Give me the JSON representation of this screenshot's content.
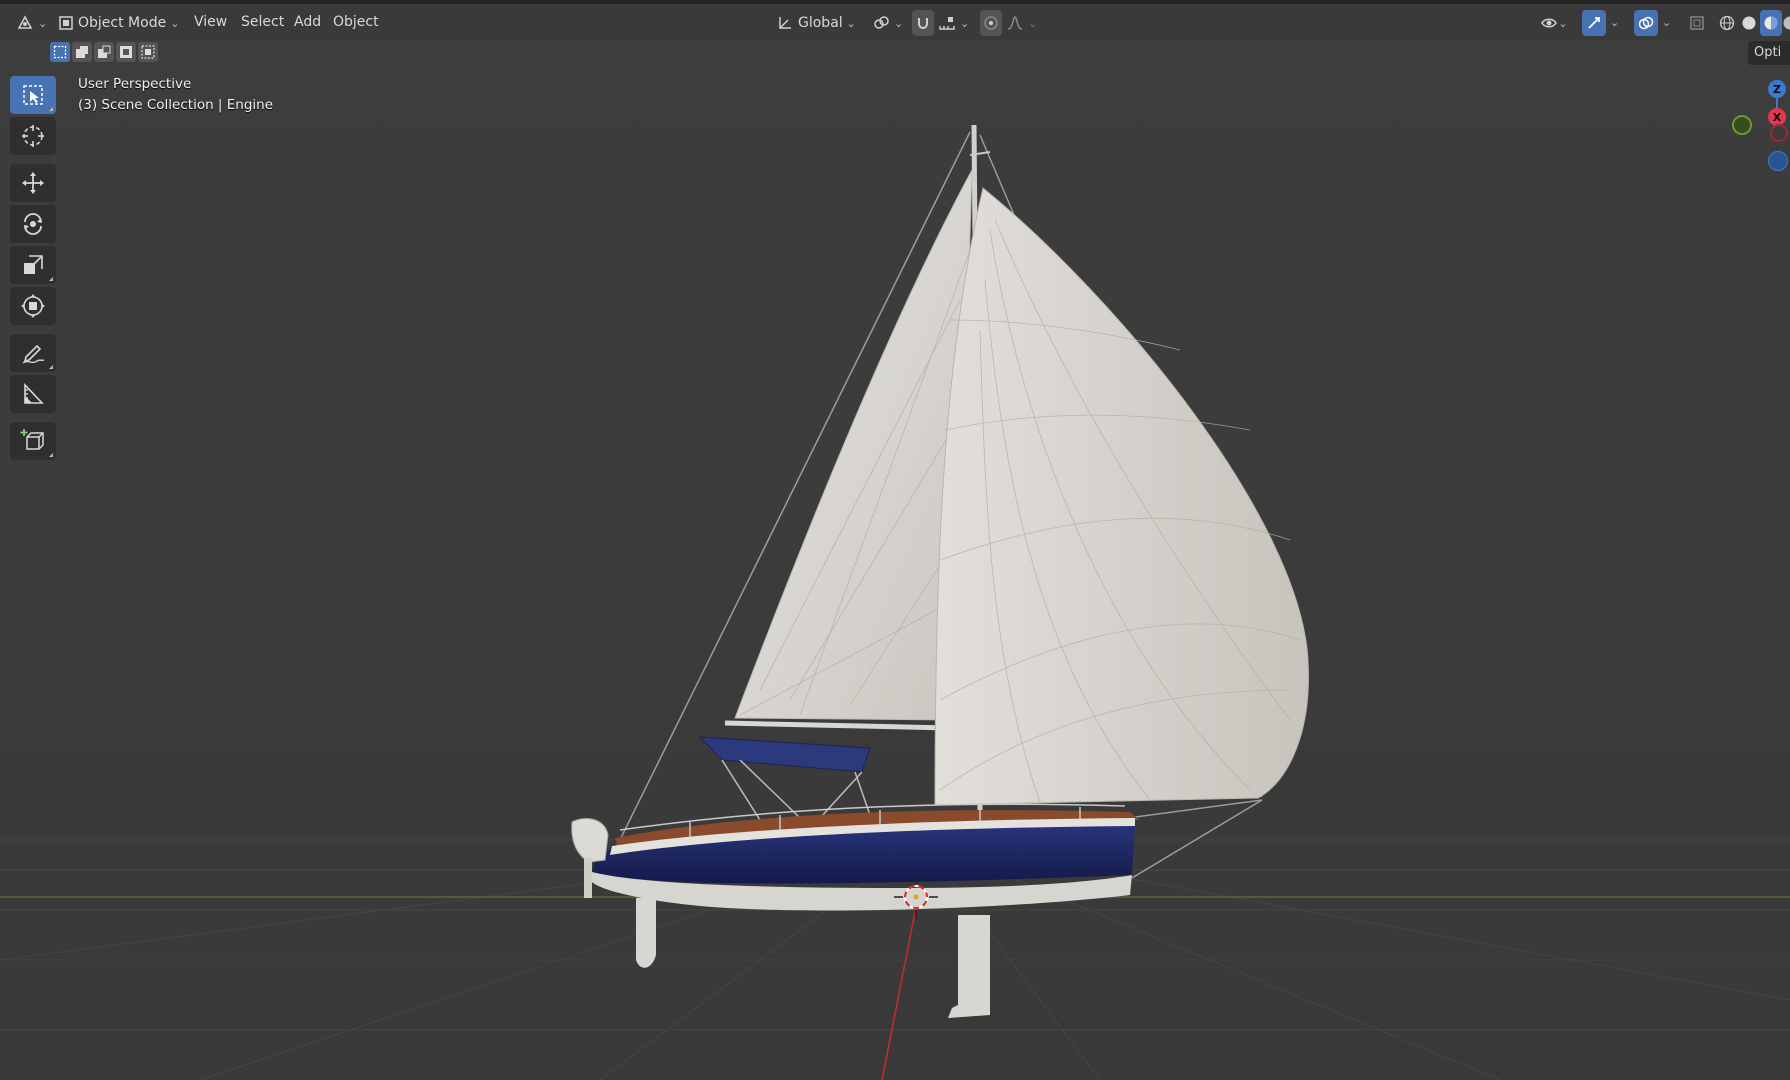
{
  "header": {
    "mode_label": "Object Mode",
    "menus": [
      "View",
      "Select",
      "Add",
      "Object"
    ],
    "transform_orientation": "Global",
    "options_tab": "Opti"
  },
  "viewport": {
    "perspective_label": "User Perspective",
    "collection_label": "(3) Scene Collection | Engine"
  },
  "toolbar": {
    "tools": [
      "select-box",
      "cursor",
      "move",
      "rotate",
      "scale",
      "transform",
      "annotate",
      "measure",
      "add-cube"
    ],
    "active_tool": "select-box"
  },
  "gizmo": {
    "z_label": "Z",
    "x_label": "X"
  },
  "colors": {
    "accent": "#4772b3",
    "hull": "#1f2a66",
    "sail": "#d9d7d2",
    "bimini": "#2e3a80",
    "deck": "#8a4a2c",
    "x_axis": "#e0384e",
    "y_axis": "#6a9a2a",
    "z_axis": "#3b7ad0"
  }
}
